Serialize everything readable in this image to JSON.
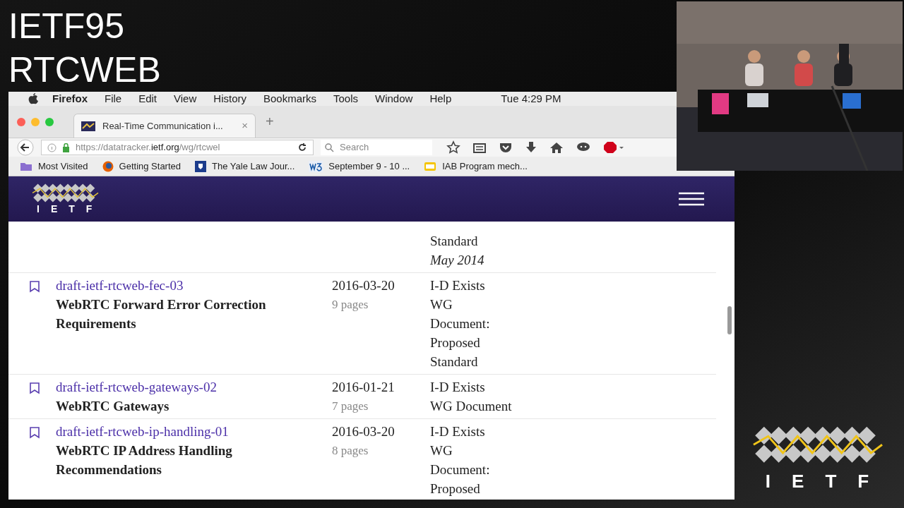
{
  "slide": {
    "title_lines": [
      "IETF95",
      "RTCWEB"
    ]
  },
  "menubar": {
    "app": "Firefox",
    "items": [
      "File",
      "Edit",
      "View",
      "History",
      "Bookmarks",
      "Tools",
      "Window",
      "Help"
    ],
    "clock": "Tue 4:29 PM"
  },
  "tab": {
    "title": "Real-Time Communication i...",
    "close": "×",
    "new_tab": "+"
  },
  "navbar": {
    "url_scheme": "https://datatracker.",
    "url_host": "ietf.org",
    "url_path": "/wg/rtcwel",
    "search_placeholder": "Search"
  },
  "bookmarks": [
    {
      "label": "Most Visited",
      "kind": "folder"
    },
    {
      "label": "Getting Started",
      "kind": "firefox"
    },
    {
      "label": "The Yale Law Jour...",
      "kind": "shield"
    },
    {
      "label": "September 9 - 10 ...",
      "kind": "w3"
    },
    {
      "label": "IAB Program mech...",
      "kind": "note"
    }
  ],
  "site": {
    "logo_text": "IETF"
  },
  "documents": [
    {
      "status": [
        "Standard"
      ],
      "updated": "May 2014"
    },
    {
      "name": "draft-ietf-rtcweb-fec-03",
      "title": "WebRTC Forward Error Correction Requirements",
      "date": "2016-03-20",
      "pages": "9 pages",
      "status": [
        "I-D Exists",
        "WG",
        "Document:",
        "Proposed",
        "Standard"
      ]
    },
    {
      "name": "draft-ietf-rtcweb-gateways-02",
      "title": "WebRTC Gateways",
      "date": "2016-01-21",
      "pages": "7 pages",
      "status": [
        "I-D Exists",
        "WG Document"
      ]
    },
    {
      "name": "draft-ietf-rtcweb-ip-handling-01",
      "title": "WebRTC IP Address Handling Recommendations",
      "date": "2016-03-20",
      "pages": "8 pages",
      "status": [
        "I-D Exists",
        "WG",
        "Document:",
        "Proposed"
      ]
    }
  ],
  "corner_logo": {
    "text": "IETF"
  }
}
